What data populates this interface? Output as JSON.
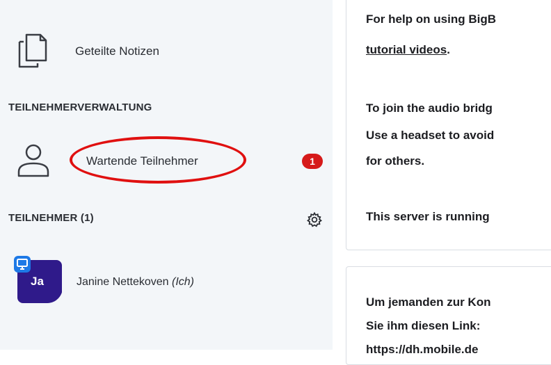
{
  "sidebar": {
    "notes_label": "Geteilte Notizen",
    "management_title": "TEILNEHMERVERWALTUNG",
    "waiting_label": "Wartende Teilnehmer",
    "waiting_count": "1",
    "participants_title": "TEILNEHMER (1)",
    "user": {
      "initials": "Ja",
      "name": "Janine Nettekoven",
      "me_tag": "(Ich)"
    }
  },
  "chat": {
    "welcome_line1": "For help on using BigB",
    "welcome_line2_link": "tutorial videos",
    "welcome_line2_end": ".",
    "audio_line1": "To join the audio bridg",
    "audio_line2": "Use a headset to avoid",
    "audio_line3": "for others.",
    "server_line": "This server is running",
    "invite_line1": "Um jemanden zur Kon",
    "invite_line2": "Sie ihm diesen Link:",
    "invite_line3": "https://dh.mobile.de"
  },
  "colors": {
    "badge": "#d61a1a",
    "annotation_circle": "#e01010",
    "avatar": "#2f1a8a",
    "presenter": "#1d79e6"
  }
}
